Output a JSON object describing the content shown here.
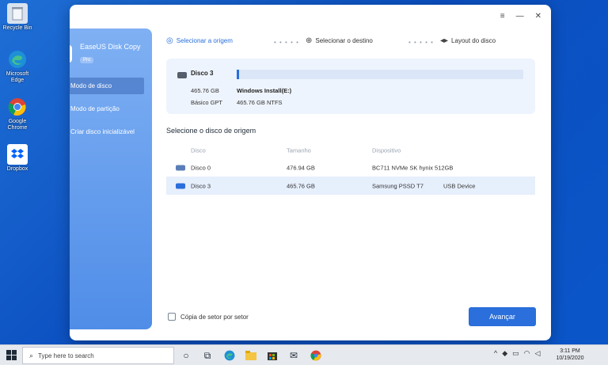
{
  "desktop": {
    "icons": [
      {
        "label": "Recycle Bin"
      },
      {
        "label": "Microsoft Edge"
      },
      {
        "label": "Google Chrome"
      },
      {
        "label": "Dropbox"
      }
    ]
  },
  "app": {
    "brand_name": "EaseUS Disk Copy",
    "brand_badge": "Pro",
    "window_controls": {
      "menu": "≡",
      "minimize": "—",
      "close": "✕"
    },
    "sidebar": {
      "items": [
        {
          "label": "Modo de disco",
          "active": true
        },
        {
          "label": "Modo de partição",
          "active": false
        },
        {
          "label": "Criar disco inicializável",
          "active": false
        }
      ]
    },
    "steps": [
      {
        "label": "Selecionar a origem",
        "icon": "target-icon",
        "active": true
      },
      {
        "label": "Selecionar o destino",
        "icon": "crosshair-icon",
        "active": false
      },
      {
        "label": "Layout do disco",
        "icon": "layout-icon",
        "active": false
      }
    ],
    "step_separator": "• • • • •",
    "selected_disk": {
      "name": "Disco 3",
      "size": "465.76 GB",
      "type": "Básico GPT",
      "partition_name": "Windows Install(E:)",
      "partition_info": "465.76 GB NTFS"
    },
    "source_section": {
      "title": "Selecione o disco de origem",
      "columns": [
        "Disco",
        "Tamanho",
        "Dispositivo"
      ],
      "rows": [
        {
          "name": "Disco 0",
          "size": "476.94 GB",
          "device": "BC711 NVMe SK hynix 512GB",
          "bus": "",
          "selected": false
        },
        {
          "name": "Disco 3",
          "size": "465.76 GB",
          "device": "Samsung  PSSD T7",
          "bus": "USB Device",
          "selected": true
        }
      ]
    },
    "sector_copy_label": "Cópia de setor por setor",
    "next_button": "Avançar"
  },
  "taskbar": {
    "search_placeholder": "Type here to search",
    "time": "3:11 PM",
    "date": "10/19/2020"
  },
  "colors": {
    "accent": "#2a6fdb",
    "sidebar_top": "#7fb0f3",
    "sidebar_bottom": "#4f8de8",
    "desktop": "#0b4fc0"
  }
}
